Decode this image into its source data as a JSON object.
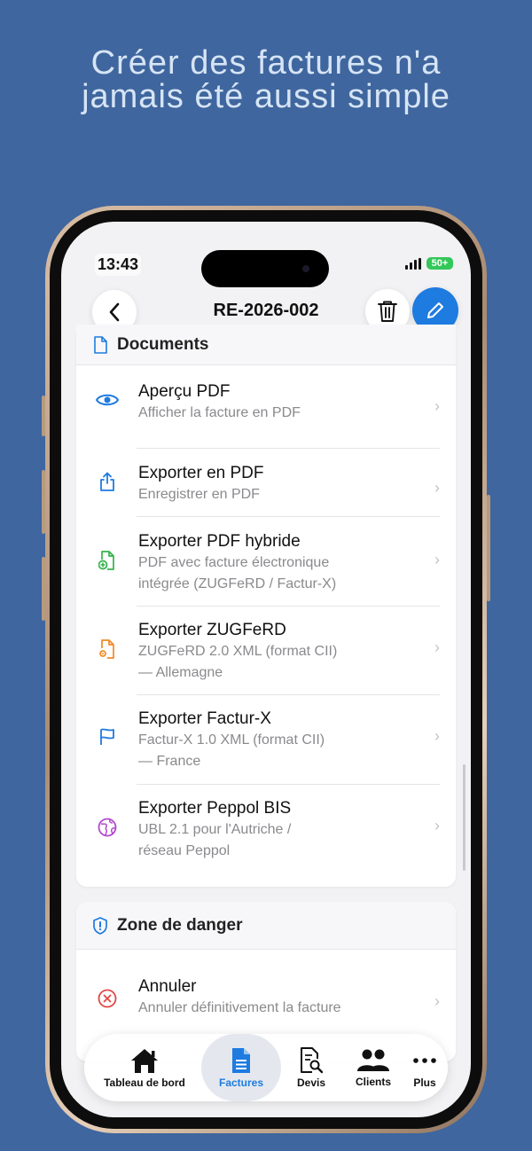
{
  "headline": {
    "line1": "Créer des factures n'a",
    "line2": "jamais été aussi simple"
  },
  "status": {
    "time": "13:43",
    "battery": "50+"
  },
  "nav": {
    "title": "RE-2026-002",
    "back_icon": "chevron-left-icon",
    "delete_icon": "trash-icon",
    "edit_icon": "pencil-icon"
  },
  "documents": {
    "header": "Documents",
    "items": [
      {
        "title": "Aperçu PDF",
        "subtitle": "Afficher la facture en PDF",
        "icon": "eye-icon",
        "color": "#1e7be0"
      },
      {
        "title": "Exporter en PDF",
        "subtitle": "Enregistrer en PDF",
        "icon": "share-icon",
        "color": "#1e7be0"
      },
      {
        "title": "Exporter PDF hybride",
        "subtitle": "PDF avec facture électronique",
        "subtitle2": "intégrée (ZUGFeRD / Factur-X)",
        "icon": "file-plus-icon",
        "color": "#34b24a"
      },
      {
        "title": "Exporter ZUGFeRD",
        "subtitle": "ZUGFeRD 2.0 XML (format CII)",
        "subtitle2": "— Allemagne",
        "icon": "file-gear-icon",
        "color": "#f08a24"
      },
      {
        "title": "Exporter Factur-X",
        "subtitle": "Factur-X 1.0 XML (format CII)",
        "subtitle2": "— France",
        "icon": "flag-icon",
        "color": "#1e7be0"
      },
      {
        "title": "Exporter Peppol BIS",
        "subtitle": "UBL 2.1 pour l'Autriche /",
        "subtitle2": "réseau Peppol",
        "icon": "globe-icon",
        "color": "#b24ad0"
      }
    ]
  },
  "danger": {
    "header": "Zone de danger",
    "items": [
      {
        "title": "Annuler",
        "subtitle": "Annuler définitivement la facture",
        "icon": "x-circle-icon",
        "color": "#e04848"
      }
    ]
  },
  "tabs": [
    {
      "label": "Tableau de bord",
      "icon": "home-icon"
    },
    {
      "label": "Factures",
      "icon": "document-icon",
      "active": true
    },
    {
      "label": "Devis",
      "icon": "document-search-icon"
    },
    {
      "label": "Clients",
      "icon": "users-icon"
    },
    {
      "label": "Plus",
      "icon": "more-icon"
    }
  ],
  "colors": {
    "background": "#3f669e",
    "accent": "#1e7be0",
    "headline": "#d6e4f5"
  }
}
